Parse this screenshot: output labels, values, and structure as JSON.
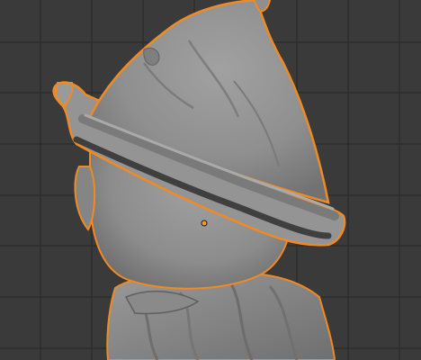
{
  "viewport": {
    "mode": "3d-viewport",
    "background_color": "#3a3a3a",
    "grid_color": "#2a2a2a",
    "selection_outline_color": "#f08a24",
    "origin_color": "#f39a2b",
    "mesh_color": "#8d8d8d"
  },
  "object": {
    "name_icon": "wizard-hat-character-mesh-icon",
    "selected": true
  }
}
